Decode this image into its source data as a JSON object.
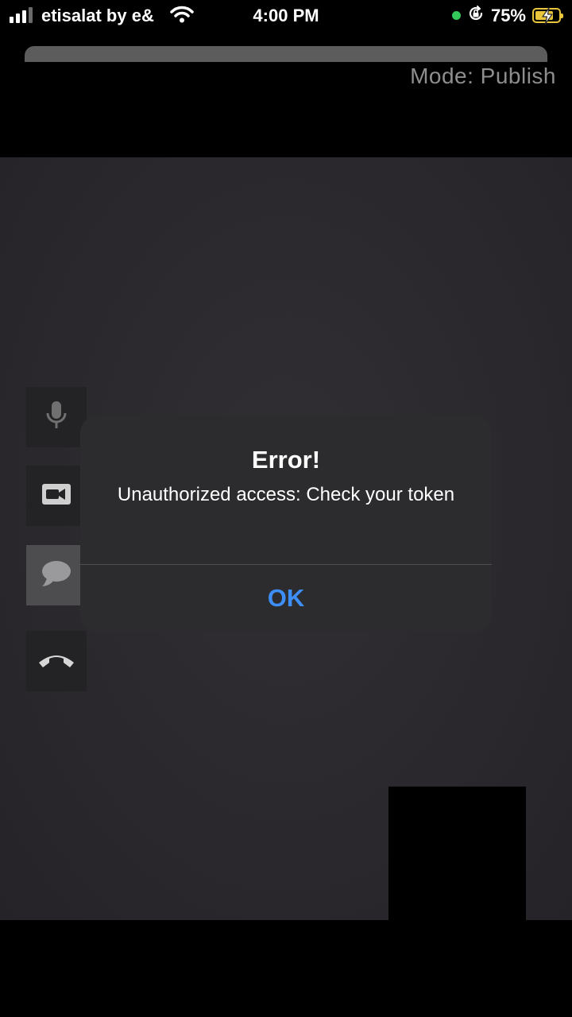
{
  "status_bar": {
    "carrier": "etisalat by e&",
    "time": "4:00 PM",
    "battery_percent": "75%",
    "signal_bars": 4,
    "signal_bars_active": 3
  },
  "header": {
    "mode_label": "Mode: Publish"
  },
  "controls": {
    "mic_icon": "microphone-icon",
    "video_icon": "video-camera-icon",
    "chat_icon": "chat-bubble-icon",
    "end_call_icon": "end-call-icon"
  },
  "alert": {
    "title": "Error!",
    "message": "Unauthorized access: Check your token",
    "ok_label": "OK"
  },
  "colors": {
    "accent_blue": "#3e8ef7",
    "battery_yellow": "#e8c53a",
    "indicator_green": "#34c759",
    "alert_background": "#2c2c2e"
  }
}
